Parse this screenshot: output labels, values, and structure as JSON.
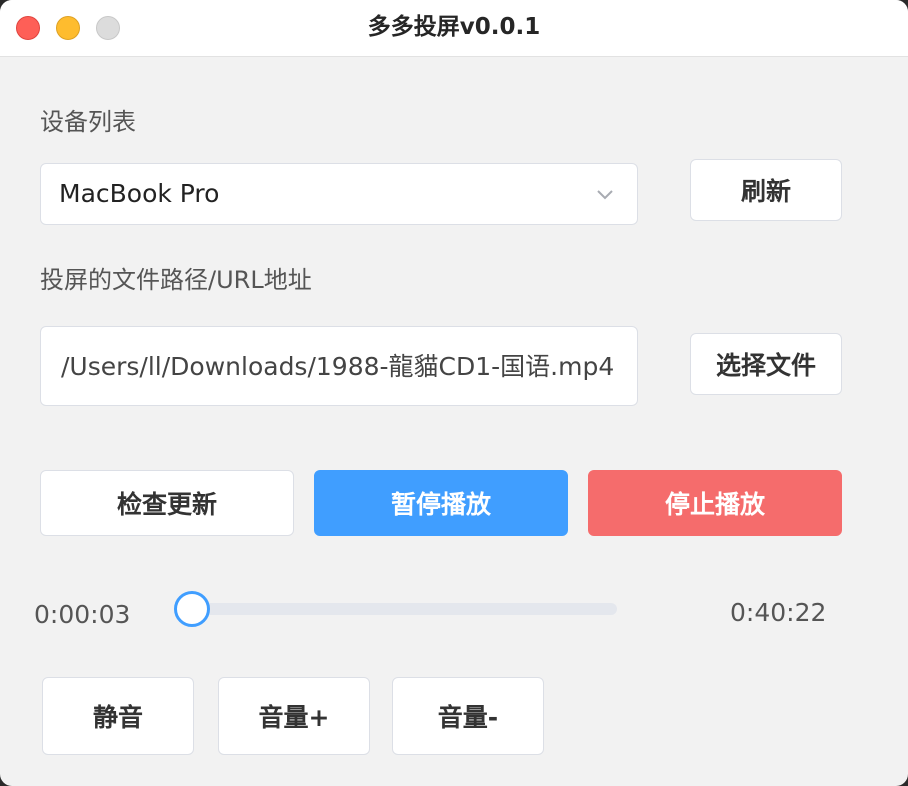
{
  "window": {
    "title": "多多投屏v0.0.1"
  },
  "device": {
    "label": "设备列表",
    "selected": "MacBook Pro",
    "refresh_label": "刷新"
  },
  "file": {
    "label": "投屏的文件路径/URL地址",
    "value": "/Users/ll/Downloads/1988-龍貓CD1-国语.mp4",
    "choose_label": "选择文件"
  },
  "actions": {
    "check_update_label": "检查更新",
    "pause_label": "暂停播放",
    "stop_label": "停止播放"
  },
  "playback": {
    "current_time": "0:00:03",
    "total_time": "0:40:22",
    "progress": 0.0012
  },
  "volume": {
    "mute_label": "静音",
    "up_label": "音量+",
    "down_label": "音量-"
  },
  "colors": {
    "primary": "#409eff",
    "danger": "#f56c6c"
  }
}
